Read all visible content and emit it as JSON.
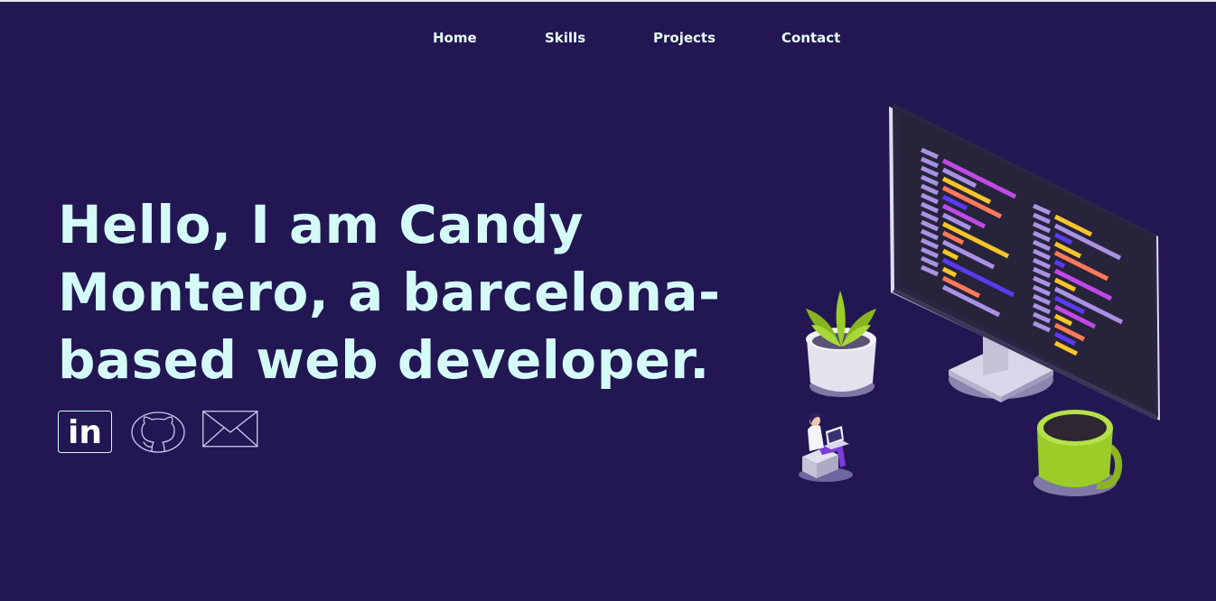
{
  "nav": {
    "items": [
      {
        "label": "Home"
      },
      {
        "label": "Skills"
      },
      {
        "label": "Projects"
      },
      {
        "label": "Contact"
      }
    ]
  },
  "hero": {
    "title": "Hello, I am Candy Montero, a barcelona-based web developer."
  },
  "socials": [
    {
      "icon": "linkedin-icon",
      "text": "in"
    },
    {
      "icon": "github-icon"
    },
    {
      "icon": "mail-icon"
    }
  ],
  "colors": {
    "background": "#221752",
    "text": "#d4fbf8",
    "accent_green": "#9bcc28",
    "accent_purple": "#a992e4"
  }
}
